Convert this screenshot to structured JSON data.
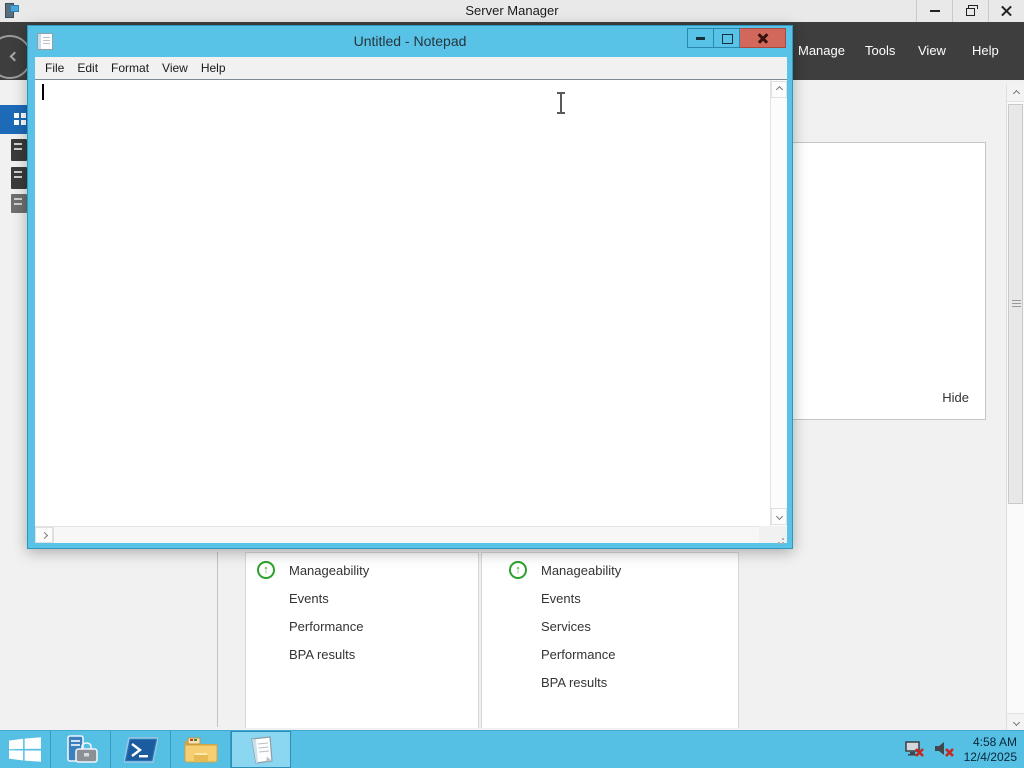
{
  "server_manager": {
    "window_title": "Server Manager",
    "band_menu": [
      "Manage",
      "Tools",
      "View",
      "Help"
    ],
    "welcome_panel": {
      "hide_label": "Hide"
    },
    "tiles": [
      {
        "rows": [
          {
            "label": "Manageability",
            "status_icon": "green-up-arrow"
          },
          {
            "label": "Events"
          },
          {
            "label": "Performance"
          },
          {
            "label": "BPA results"
          }
        ]
      },
      {
        "rows": [
          {
            "label": "Manageability",
            "status_icon": "green-up-arrow"
          },
          {
            "label": "Events"
          },
          {
            "label": "Services"
          },
          {
            "label": "Performance"
          },
          {
            "label": "BPA results"
          }
        ]
      }
    ]
  },
  "notepad": {
    "window_title": "Untitled - Notepad",
    "menu": [
      "File",
      "Edit",
      "Format",
      "View",
      "Help"
    ],
    "text_content": ""
  },
  "taskbar": {
    "clock": {
      "time": "4:58 AM",
      "date": "12/4/2025"
    }
  },
  "icons": {
    "green_up_arrow": "↑"
  },
  "colors": {
    "accent_cyan": "#58c3e7",
    "taskbar_cyan": "#55c0e4",
    "band_dark": "#3e3e3e",
    "close_red": "#d2685c",
    "selection_blue": "#1d6ab8",
    "status_green": "#2aa12a"
  }
}
